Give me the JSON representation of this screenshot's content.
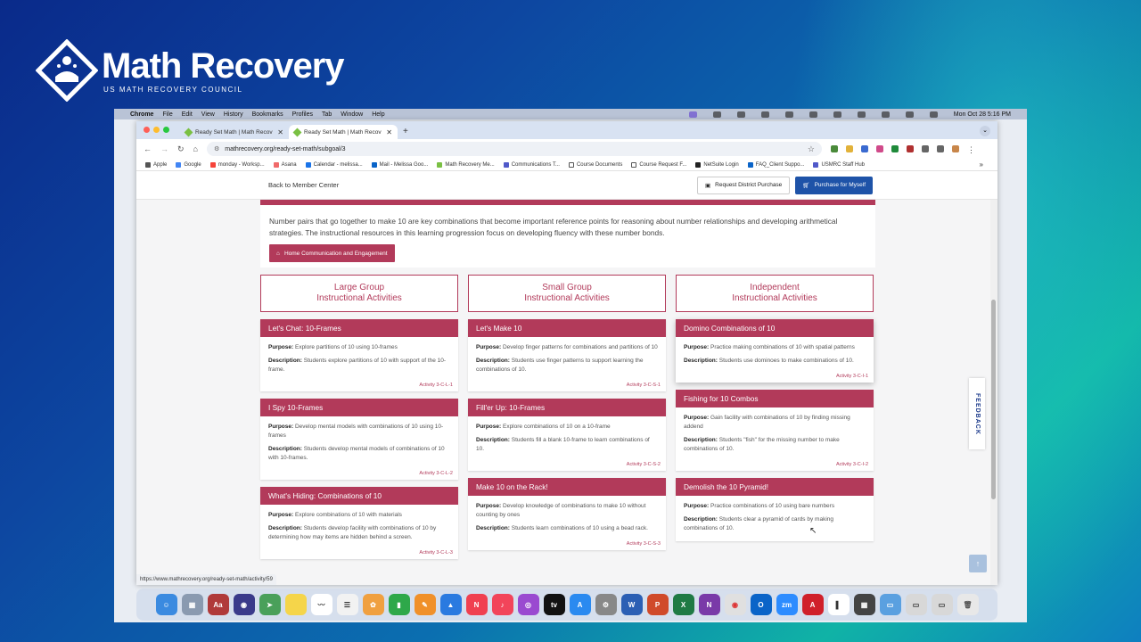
{
  "logo": {
    "title": "Math Recovery",
    "subtitle": "US MATH RECOVERY COUNCIL"
  },
  "menubar": {
    "items": [
      "Chrome",
      "File",
      "Edit",
      "View",
      "History",
      "Bookmarks",
      "Profiles",
      "Tab",
      "Window",
      "Help"
    ],
    "datetime": "Mon Oct 28  5:16 PM"
  },
  "tabs": [
    {
      "title": "Ready Set Math | Math Recov"
    },
    {
      "title": "Ready Set Math | Math Recov"
    }
  ],
  "address": {
    "url": "mathrecovery.org/ready-set-math/subgoal/3"
  },
  "bookmarks": [
    "Apple",
    "Google",
    "monday - Worksp...",
    "Asana",
    "Calendar - melissa...",
    "Mail - Melissa Goo...",
    "Math Recovery Me...",
    "Communications T...",
    "Course Documents",
    "Course Request F...",
    "NetSuite Login",
    "FAQ_Client Suppo...",
    "USMRC Staff Hub"
  ],
  "topnav": {
    "back_label": "Back to Member Center",
    "district_label": "Request District Purchase",
    "purchase_label": "Purchase for Myself"
  },
  "intro": {
    "text": "Number pairs that go together to make 10 are key combinations that become important reference points for reasoning about number relationships and developing arithmetical strategies. The instructional resources in this learning progression focus on developing fluency with these number bonds.",
    "home_button": "Home Communication and Engagement"
  },
  "labels": {
    "purpose": "Purpose:",
    "description": "Description:"
  },
  "columns": [
    {
      "heading_line1": "Large Group",
      "heading_line2": "Instructional Activities",
      "cards": [
        {
          "title": "Let's Chat: 10-Frames",
          "purpose": "Explore partitions of 10 using 10-frames",
          "description": "Students explore partitions of 10 with support of the 10-frame.",
          "code": "Activity 3-C-L-1"
        },
        {
          "title": "I Spy 10-Frames",
          "purpose": "Develop mental models with combinations of 10 using 10-frames",
          "description": "Students develop mental models of combinations of 10 with 10-frames.",
          "code": "Activity 3-C-L-2"
        },
        {
          "title": "What's Hiding: Combinations of 10",
          "purpose": "Explore combinations of 10 with materials",
          "description": "Students develop facility with combinations of 10 by determining how may items are hidden behind a screen.",
          "code": "Activity 3-C-L-3"
        }
      ]
    },
    {
      "heading_line1": "Small Group",
      "heading_line2": "Instructional Activities",
      "cards": [
        {
          "title": "Let's Make 10",
          "purpose": "Develop finger patterns for combinations and partitions of 10",
          "description": "Students use finger patterns to support learning the combinations of 10.",
          "code": "Activity 3-C-S-1"
        },
        {
          "title": "Fill'er Up: 10-Frames",
          "purpose": "Explore combinations of 10 on a 10-frame",
          "description": "Students fill a blank 10-frame to learn combinations of 10.",
          "code": "Activity 3-C-S-2"
        },
        {
          "title": "Make 10 on the Rack!",
          "purpose": "Develop knowledge of combinations to make 10 without counting by ones",
          "description": "Students learn combinations of 10 using a bead rack.",
          "code": "Activity 3-C-S-3"
        }
      ]
    },
    {
      "heading_line1": "Independent",
      "heading_line2": "Instructional Activities",
      "cards": [
        {
          "title": "Domino Combinations of 10",
          "purpose": "Practice making combinations of 10 with spatial patterns",
          "description": "Students use dominoes to make combinations of 10.",
          "code": "Activity 3-C-I-1"
        },
        {
          "title": "Fishing for 10 Combos",
          "purpose": "Gain facility with combinations of 10 by finding missing addend",
          "description": "Students \"fish\" for the missing number to make combinations of 10.",
          "code": "Activity 3-C-I-2"
        },
        {
          "title": "Demolish the 10 Pyramid!",
          "purpose": "Practice combinations of 10 using bare numbers",
          "description": "Students clear a pyramid of cards by making combinations of 10.",
          "code": ""
        }
      ]
    }
  ],
  "feedback_label": "FEEDBACK",
  "status_url": "https://www.mathrecovery.org/ready-set-math/activity/59",
  "colors": {
    "accent": "#b23a5a",
    "primary_button": "#1e53a8"
  }
}
